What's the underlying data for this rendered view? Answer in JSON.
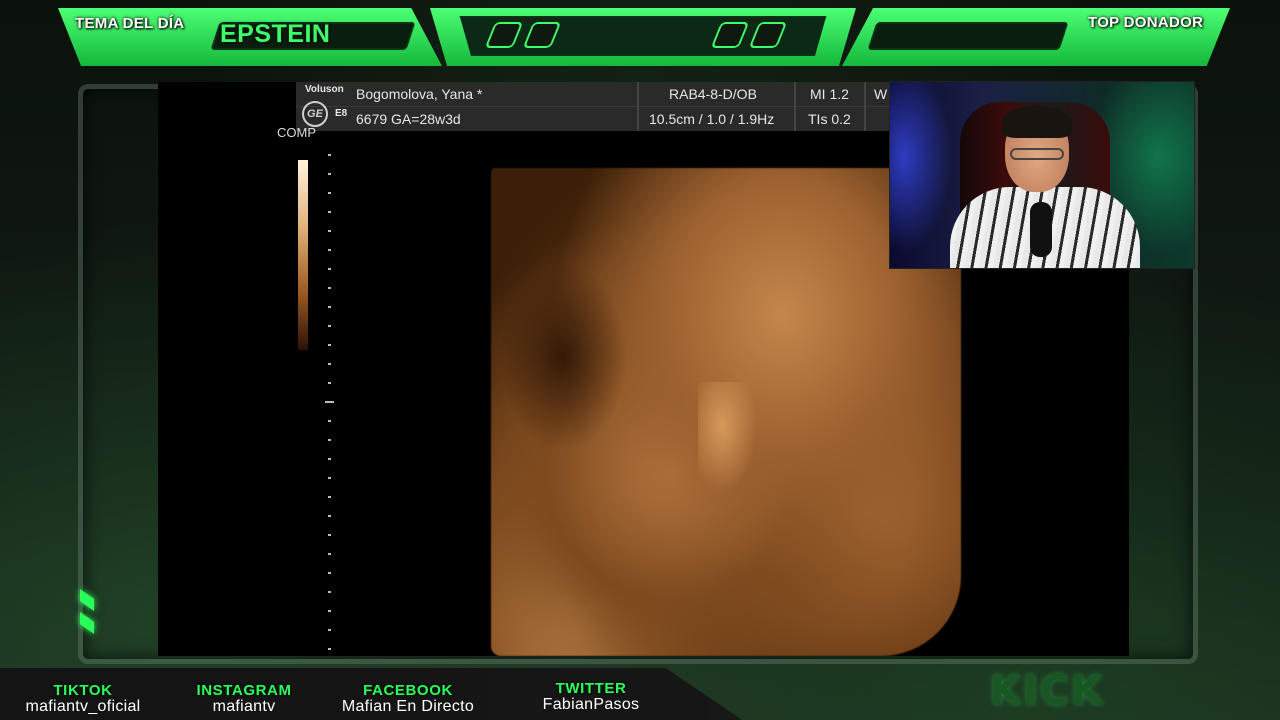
{
  "hud": {
    "left_label": "TEMA DEL DÍA",
    "topic": "EPSTEIN",
    "right_label": "TOP DONADOR"
  },
  "ultrasound": {
    "brand_top": "Voluson",
    "brand_model": "E8",
    "ge_logo": "GE",
    "patient": "Bogomolova, Yana  *",
    "id_ga": "6679  GA=28w3d",
    "probe": "RAB4-8-D/OB",
    "settings": "10.5cm / 1.0 / 1.9Hz",
    "mi": "MI  1.2",
    "tis": "TIs  0.2",
    "w": "W",
    "comp": "COMP"
  },
  "social": [
    {
      "name": "TIKTOK",
      "handle": "mafiantv_oficial"
    },
    {
      "name": "INSTAGRAM",
      "handle": "mafiantv"
    },
    {
      "name": "FACEBOOK",
      "handle": "Mafian En Directo"
    },
    {
      "name": "TWITTER",
      "handle": "FabianPasos"
    }
  ],
  "watermark": "KICK",
  "colors": {
    "accent": "#2bff5a",
    "hud_green": "#3dff6a",
    "background": "#0a0f0b"
  },
  "icons": [
    "ge-logo-icon",
    "chevron-icon"
  ]
}
